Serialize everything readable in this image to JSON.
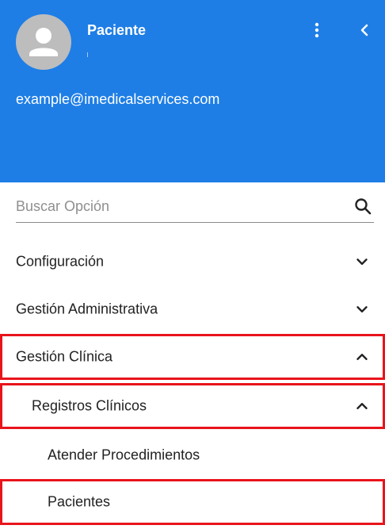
{
  "header": {
    "user_name": "Paciente",
    "email": "example@imedicalservices.com",
    "background_color": "#1e7ee6"
  },
  "search": {
    "placeholder": "Buscar Opción",
    "value": ""
  },
  "menu": {
    "items": [
      {
        "label": "Configuración",
        "icon": "chevron-down-icon"
      },
      {
        "label": "Gestión Administrativa",
        "icon": "chevron-down-icon"
      },
      {
        "label": "Gestión Clínica",
        "icon": "chevron-up-icon"
      },
      {
        "label": "Registros Clínicos",
        "icon": "chevron-up-icon"
      },
      {
        "label": "Atender Procedimientos"
      },
      {
        "label": "Pacientes"
      }
    ]
  },
  "highlight_color": "#e8141b"
}
